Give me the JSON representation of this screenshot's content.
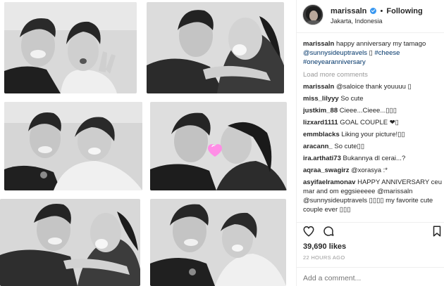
{
  "post": {
    "username": "marissaln",
    "follow_separator": "•",
    "follow_label": "Following",
    "location": "Jakarta, Indonesia",
    "caption": {
      "username": "marissaln",
      "text_1": " happy anniversary my tamago ",
      "mention": "@sunnysideuptravels",
      "text_2": " ▯ ",
      "tag_1": "#cheese",
      "tag_2": "#oneyearanniversary"
    },
    "load_more": "Load more comments",
    "likes": "39,690 likes",
    "time": "22 HOURS AGO",
    "add_comment_placeholder": "Add a comment..."
  },
  "comments": [
    {
      "user": "marissaln",
      "text": " @saloice thank youuuu ▯"
    },
    {
      "user": "miss_lilyyy",
      "text": " So cute"
    },
    {
      "user": "justkim_88",
      "text": " Cieee...Cieee...▯▯▯"
    },
    {
      "user": "lizxard1111",
      "text": " GOAL COUPLE ❤▯"
    },
    {
      "user": "emmblacks",
      "text": " Liking your picture!▯▯"
    },
    {
      "user": "aracann_",
      "text": " So cute▯▯"
    },
    {
      "user": "ira.arthati73",
      "text": " Bukannya dl cerai...?"
    },
    {
      "user": "aqraa_swagirz",
      "text": " @xorasya :*"
    },
    {
      "user": "asyifaelramonav",
      "text": " HAPPY ANNIVERSARY ceu mar and om eggsieeeee @marissaln @sunnysideuptravels ▯▯▯▯ my favorite cute couple ever ▯▯▯"
    }
  ],
  "icons": {
    "heart": "heart-icon",
    "comment": "comment-icon",
    "bookmark": "bookmark-icon",
    "verified": "verified-badge-icon",
    "kiss_sticker": "heart-sticker-icon"
  },
  "colors": {
    "link": "#003569",
    "muted": "#999999",
    "verified": "#3897f0",
    "sticker": "#ff8ee6"
  }
}
